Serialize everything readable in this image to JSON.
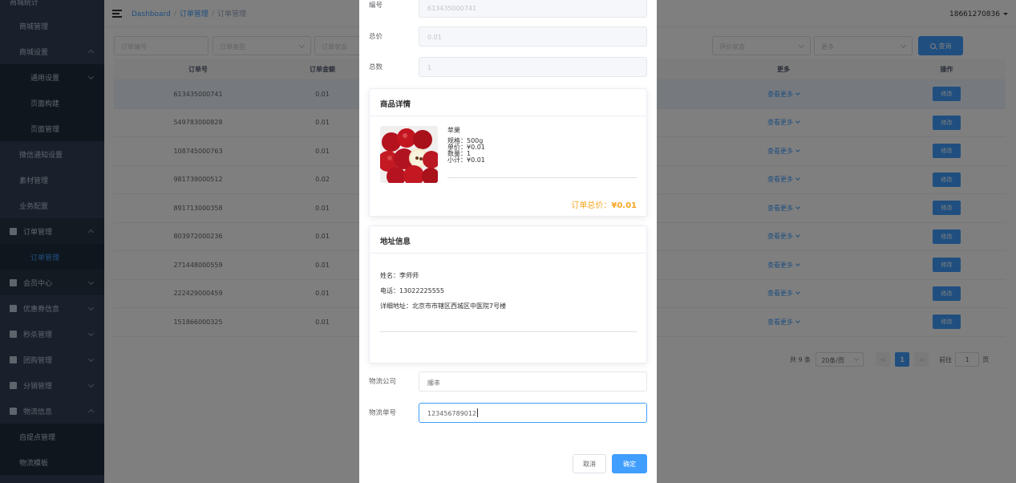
{
  "sidebar": {
    "items": [
      {
        "label": "商城统计",
        "type": "top"
      },
      {
        "label": "商城管理",
        "type": "item"
      },
      {
        "label": "商城设置",
        "type": "item-expand"
      },
      {
        "label": "通用设置",
        "type": "sub-expand"
      },
      {
        "label": "页面构建",
        "type": "sub"
      },
      {
        "label": "页面管理",
        "type": "sub"
      },
      {
        "label": "微信通知设置",
        "type": "item"
      },
      {
        "label": "素材管理",
        "type": "item"
      },
      {
        "label": "业务配置",
        "type": "item"
      },
      {
        "label": "订单管理",
        "type": "group-open"
      },
      {
        "label": "订单管理",
        "type": "sub-active"
      },
      {
        "label": "会员中心",
        "type": "group"
      },
      {
        "label": "优惠券信息",
        "type": "group"
      },
      {
        "label": "秒杀管理",
        "type": "group"
      },
      {
        "label": "团购管理",
        "type": "group"
      },
      {
        "label": "分销管理",
        "type": "group"
      },
      {
        "label": "物流信息",
        "type": "group-open"
      },
      {
        "label": "自提点管理",
        "type": "item"
      },
      {
        "label": "物流模板",
        "type": "item"
      }
    ]
  },
  "navbar": {
    "breadcrumb": [
      "Dashboard",
      "订单管理",
      "订单管理"
    ],
    "separator": "/",
    "user": "18661270836"
  },
  "filters": {
    "order_no": "订单编号",
    "order_type": "订单类型",
    "order_status": "订单状态",
    "eval_status": "评价状态",
    "more": "更多",
    "query": "查询"
  },
  "table": {
    "headers": {
      "order_no": "订单号",
      "amount": "订单金额",
      "more": "更多",
      "op": "操作"
    },
    "more_label": "查看更多",
    "edit_label": "修改",
    "rows": [
      {
        "order_no": "613435000741",
        "amount": "0.01"
      },
      {
        "order_no": "549783000828",
        "amount": "0.01"
      },
      {
        "order_no": "108745000763",
        "amount": "0.01"
      },
      {
        "order_no": "981739000512",
        "amount": "0.02"
      },
      {
        "order_no": "891713000358",
        "amount": "0.01"
      },
      {
        "order_no": "803972000236",
        "amount": "0.01"
      },
      {
        "order_no": "271448000559",
        "amount": "0.01"
      },
      {
        "order_no": "222429000459",
        "amount": "0.01"
      },
      {
        "order_no": "151866000325",
        "amount": "0.01"
      }
    ]
  },
  "pagination": {
    "total": "共 9 条",
    "page_size": "20条/页",
    "prev": "<",
    "current": "1",
    "next": ">",
    "goto": "前往",
    "goto_value": "1",
    "page_unit": "页"
  },
  "dialog": {
    "fields": {
      "number_label": "编号",
      "number_value": "613435000741",
      "total_price_label": "总价",
      "total_price_value": "0.01",
      "total_count_label": "总数",
      "total_count_value": "1"
    },
    "product_card": {
      "title": "商品详情",
      "product_name": "苹果",
      "spec": "规格：500g",
      "unit_price": "单价：¥0.01",
      "quantity": "数量：1",
      "subtotal": "小计：¥0.01",
      "total_label": "订单总价：",
      "total_value": "¥0.01"
    },
    "address_card": {
      "title": "地址信息",
      "name": "姓名：李师师",
      "phone": "电话：13022225555",
      "address": "详细地址：北京市市辖区西城区中医院7号楼"
    },
    "logistics": {
      "company_label": "物流公司",
      "company_value": "顺丰",
      "tracking_label": "物流单号",
      "tracking_value": "123456789012"
    },
    "cancel": "取消",
    "confirm": "确定"
  },
  "colors": {
    "primary": "#409eff",
    "sidebar_bg": "#304156",
    "price": "#f5a623"
  }
}
